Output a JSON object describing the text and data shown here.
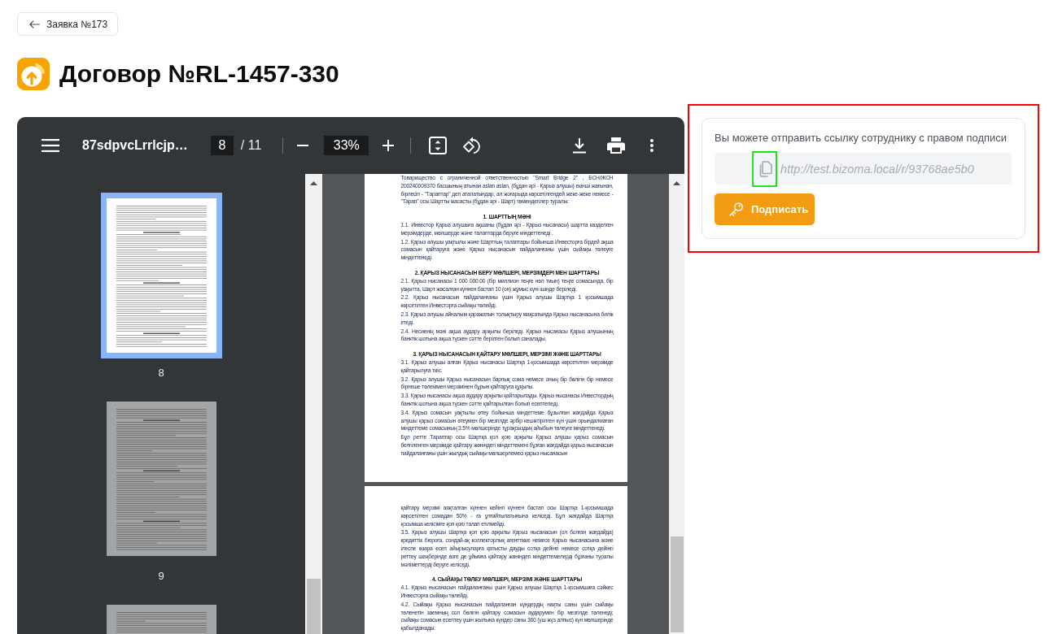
{
  "back_button": {
    "label": "Заявка №173"
  },
  "title": "Договор №RL-1457-330",
  "pdf_viewer": {
    "toolbar": {
      "file_name": "87sdpvcLrrlcjp…",
      "page": "8",
      "page_count": "/ 11",
      "zoom": "33%"
    },
    "thumbnails": [
      {
        "label": "8",
        "selected": true
      },
      {
        "label": "9",
        "selected": false
      },
      {
        "selected": false
      }
    ],
    "pages": [
      {
        "blocks": [
          {
            "kind": "paragraph",
            "text": "Товарищество с ограниченной ответственностью \"Smart Bridge 2\" , БСН/ЖСН 200240009370 басшының атынан aslan aslan, (бұдан әрі - Қарыз алушы) екінші жағынан, бірлесіп - \"Тараптар\" деп аталатындар, ал жоғарыда көрсетілгендей жеке-жеке немесе - \"Тарап\" осы Шартты жасасты (бұдан әрі - Шарт) төмендегілер туралы:"
          },
          {
            "kind": "heading",
            "text": "1. ШАРТТЫҢ МӘНІ"
          },
          {
            "kind": "paragraph",
            "text": "1.1. Инвестор Қарыз алушыға ақшаны (бұдан әрі - Қарыз нысанасы) шартта көзделген мерзімдерде, мөлшерде және талаптарда беруге міндеттенеді ."
          },
          {
            "kind": "paragraph",
            "text": "1.2. Қарыз алушы уақтылы және Шарттың талаптары бойынша Инвесторға бірдей ақша сомасын қайтаруға және Қарыз нысанасын пайдаланғаны үшін сыйақы төлеуге міндеттенеді."
          },
          {
            "kind": "heading",
            "text": "2. ҚАРЫЗ НЫСАНАСЫН БЕРУ МӨЛШЕРІ, МЕРЗІМДЕРІ МЕН ШАРТТАРЫ"
          },
          {
            "kind": "paragraph",
            "text": "2.1. Қарыз нысанасы 1 000 000.00 (бір миллион теңге нөл тиын) теңге сомасында, бір уақытта, Шарт жасалған күннен бастап 10 (он) жұмыс күні ішінде беріледі."
          },
          {
            "kind": "paragraph",
            "text": "2.2. Қарыз нысанасын пайдаланғаны үшін Қарыз алушы Шартқа 1 қосымшада көрсетілген Инвесторға сыйақы төлейді."
          },
          {
            "kind": "paragraph",
            "text": "2.3. Қарыз алушы айналым қаражатын толықтыру мақсатында Қарыз нысанасына билік етеді."
          },
          {
            "kind": "paragraph",
            "text": "2.4. Несиенің мәні ақша аудару арқылы беріледі. Қарыз нысанасы Қарыз алушының банктік шотына ақша түскен сәтте берілген болып саналады."
          },
          {
            "kind": "heading",
            "text": "3. ҚАРЫЗ НЫСАНАСЫН ҚАЙТАРУ МӨЛШЕРІ, МЕРЗІМІ ЖӘНЕ ШАРТТАРЫ"
          },
          {
            "kind": "paragraph",
            "text": "3.1. Қарыз алушы алған Қарыз нысанасы Шартқа 1-қосымшада көрсетілген мерзімде қайтарылуға тиіс."
          },
          {
            "kind": "paragraph",
            "text": "3.2. Қарыз алушы Қарыз нысанасын барлық сома немесе оның бір бөлігін бір немесе бірнеше төлеммен мерзімінен бұрын қайтаруға құқылы."
          },
          {
            "kind": "paragraph",
            "text": "3.3. Қарыз нысанасы ақша аудару арқылы қайтарылады. Қарыз нысанасы Инвестордың банктік шотына ақша түскен сәтте қайтарылған болып есептеледі."
          },
          {
            "kind": "paragraph",
            "text": "3.4. Қарыз сомасын уақтылы өтеу бойынша міндеттеме бұзылған жағдайда Қарыз алушы қарыз сомасын өтеумен бір мезгілде әрбір кешіктірілген күн үшін орындалмаған міндеттеме сомасының 3.5% мөлшерінде тұрақсыздық айыбын төлеуге міндеттенеді."
          },
          {
            "kind": "paragraph",
            "text": "Бұл ретте Тараптар осы Шартқа қол қою арқылы Қарыз алушы қарыз сомасын белгіленген мерзімде қайтару жөніндегі міндеттемені бұзған жағдайда қарыз нысанасын пайдаланғаны үшін жылдық сыйақы мөлшерлемесі қарыз нысанасын"
          }
        ]
      },
      {
        "blocks": [
          {
            "kind": "paragraph",
            "text": "қайтару мерзімі аяқталған күннен кейінгі күннен бастап осы Шартқа 1-қосымшада көрсетілген сомадан 50% - ға ұлғайтылатынына келіседі. Бұл жағдайда Шартқа қосымша келісімге қол қою талап етілмейді."
          },
          {
            "kind": "paragraph",
            "text": "3.5. Қарыз алушы Шартқа қол қою арқылы Қарыз нысанасын (ол болған жағдайда) кредиттік бюроға, сондай-ақ коллекторлық агенттікке немесе Қарыз нысанасына және ілеспе өзара есеп айырысуларға қатысты дауды сотқа дейінгі немесе сотқа дейінгі реттеу шеңберінде өзге де ұйымға қайтару жөніндегі міндеттемелерді бұзғаны туралы мәліметтерді беруге келіседі."
          },
          {
            "kind": "heading",
            "text": "4. СЫЙАҚЫ ТӨЛЕУ МӨЛШЕРІ, МЕРЗІМІ ЖӘНЕ ШАРТТАРЫ"
          },
          {
            "kind": "paragraph",
            "text": "4.1. Қарыз нысанасын пайдаланғаны үшін Қарыз алушы Шартқа 1-қосымшаға сәйкес Инвесторға сыйақы төлейді."
          },
          {
            "kind": "paragraph",
            "text": "4.2. Сыйақы Қарыз нысанасын пайдаланған күндердің нақты саны үшін сыйақы төленетін заемның сол бөлігін қайтару сомасын аударумен бір мезгілде төленеді; сыйақы сомасын есептеу үшін жылына күндер саны 360 (үш жүз алпыс) күн мөлшерінде қабылданады."
          }
        ]
      }
    ]
  },
  "share_panel": {
    "highlighted": true,
    "hint": "Вы можете отправить ссылку сотруднику с правом подписи",
    "link": "http://test.bizoma.local/r/93768ae5b0",
    "copy_button": {
      "highlighted": true
    },
    "sign_button": "Подписать"
  }
}
